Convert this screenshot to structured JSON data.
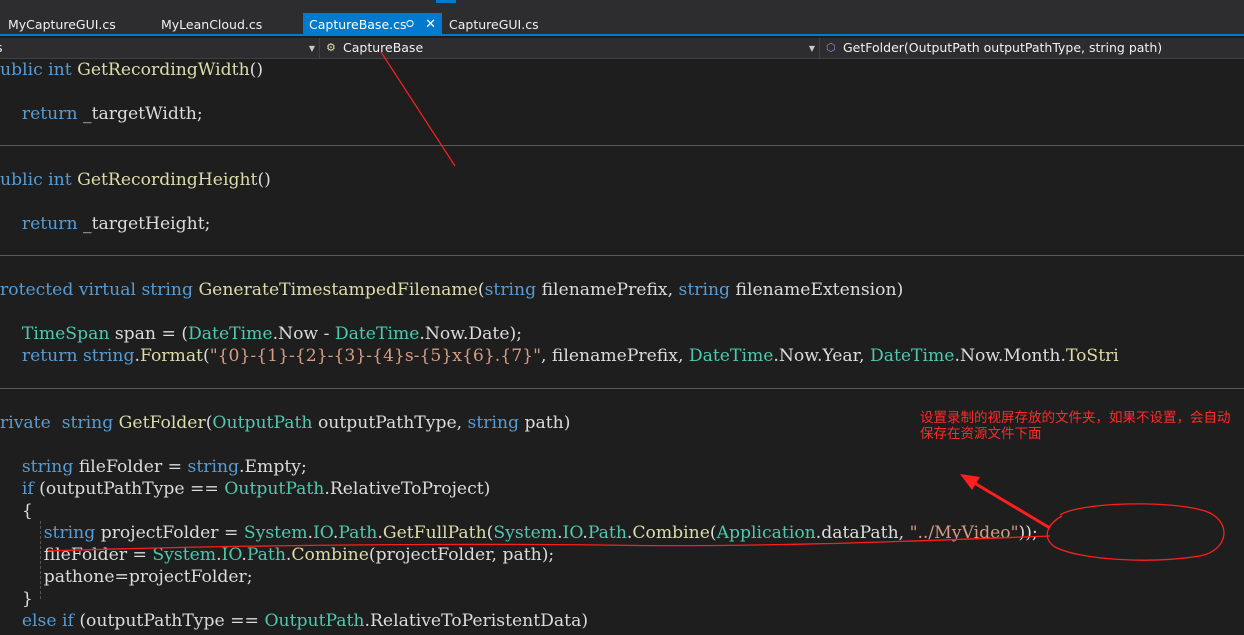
{
  "tabs": [
    {
      "label": "MyCaptureGUI.cs",
      "active": false
    },
    {
      "label": "MyLeanCloud.cs",
      "active": false
    },
    {
      "label": "CaptureBase.cs",
      "active": true,
      "pin_icon": "pin-icon",
      "close_icon": "close-icon"
    },
    {
      "label": "CaptureGUI.cs",
      "active": false
    }
  ],
  "navbar": {
    "project_value": "s",
    "class_value": "CaptureBase",
    "member_value": "GetFolder(OutputPath outputPathType, string path)",
    "class_icon": "class-icon",
    "method_icon": "method-icon",
    "dropdown_icon": "chevron-down-icon"
  },
  "code": {
    "lines": [
      "ublic int GetRecordingWidth()",
      "",
      "    return _targetWidth;",
      "ublic int GetRecordingHeight()",
      "",
      "    return _targetHeight;",
      "rotected virtual string GenerateTimestampedFilename(string filenamePrefix, string filenameExtension)",
      "    TimeSpan span = (DateTime.Now - DateTime.Now.Date);",
      "    return string.Format(\"{0}-{1}-{2}-{3}-{4}s-{5}x{6}.{7}\", filenamePrefix, DateTime.Now.Year, DateTime.Now.Month.ToStri",
      "rivate  string GetFolder(OutputPath outputPathType, string path)",
      "    string fileFolder = string.Empty;",
      "    if (outputPathType == OutputPath.RelativeToProject)",
      "    {",
      "        string projectFolder = System.IO.Path.GetFullPath(System.IO.Path.Combine(Application.dataPath, \"../MyVideo\"));",
      "        fileFolder = System.IO.Path.Combine(projectFolder, path);",
      "        pathone=projectFolder;",
      "    }",
      "    else if (outputPathType == OutputPath.RelativeToPeristentData)"
    ]
  },
  "annotation": {
    "note": "设置录制的视屏存放的文件夹，如果不设置，会自动保存在资源文件下面",
    "color": "#ff1e1e"
  },
  "colors": {
    "accent": "#007acc",
    "background": "#1e1e1e",
    "keyword": "#569cd6",
    "type": "#4ec9b0",
    "method": "#dcdcaa",
    "string": "#d69d85",
    "identifier": "#9cdcfe"
  }
}
